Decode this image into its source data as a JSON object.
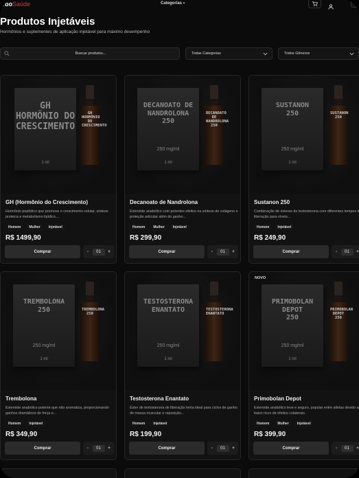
{
  "header": {
    "logo_main": "urbo",
    "logo_accent": "Saúde",
    "categories_menu": "Categorias"
  },
  "page": {
    "title": "Produtos Injetáveis",
    "subtitle": "Hormônios e suplementes de aplicação injetável para máximo desempenho"
  },
  "filters": {
    "search_placeholder": "Buscar produtos...",
    "category_select": "Todas Categorias",
    "gender_select": "Todos Gêneros"
  },
  "colors": {
    "background": "#0b0b0b",
    "card": "#121212",
    "button": "#2b2b2b",
    "logo_accent": "#d9363e"
  },
  "products": [
    {
      "name": "GH (Hormônio do Crescimento)",
      "description": "Hormônio peptídico que promove o crescimento celular, síntese proteica e metabolismo lipídico,...",
      "tags": [
        "Homem",
        "Mulher",
        "Injetável"
      ],
      "price": "R$ 1499,90",
      "box_text": "GH\nHORMÔNIO DO\nCRESCIMENTO",
      "box_dose": "",
      "box_ml": "1 ml",
      "vial_label": "GH\nHORMÔNIO\nDO\nCRESCIMENTO",
      "buy_label": "Comprar",
      "quantity": "01",
      "badge": ""
    },
    {
      "name": "Decanoato de Nandrolona",
      "description": "Esteroide anabólico com potentes efeitos na síntese de colágeno e proteção articular além do ganho...",
      "tags": [
        "Homem",
        "Mulher",
        "Injetável"
      ],
      "price": "R$ 299,90",
      "box_text": "DECANOATO DE\nNANDROLONA\n250",
      "box_dose": "250 mg/ml",
      "box_ml": "1 ml",
      "vial_label": "DECANOATO\nDE\nNANDROLONA\n250",
      "buy_label": "Comprar",
      "quantity": "01",
      "badge": ""
    },
    {
      "name": "Sustanon 250",
      "description": "Combinação de ésteres de testosterona com diferentes tempos de liberação para níveis...",
      "tags": [
        "Homem",
        "Injetável"
      ],
      "price": "R$ 249,90",
      "box_text": "SUSTANON\n250",
      "box_dose": "250 mg/ml",
      "box_ml": "1 ml",
      "vial_label": "SUSTANON\n250",
      "buy_label": "Comprar",
      "quantity": "01",
      "badge": ""
    },
    {
      "name": "Trembolona",
      "description": "Esteroide anabólico potente que não aromatiza, proporcionando ganhos dramáticos de força e...",
      "tags": [
        "Homem",
        "Injetável"
      ],
      "price": "R$ 349,90",
      "box_text": "TREMBOLONA\n250",
      "box_dose": "250 mg/ml",
      "box_ml": "1 ml",
      "vial_label": "TREMBOLONA\n250",
      "buy_label": "Comprar",
      "quantity": "01",
      "badge": ""
    },
    {
      "name": "Testosterona Enantato",
      "description": "Éster de testosterona de liberação lenta ideal para ciclos de ganho de massa muscular e reposição...",
      "tags": [
        "Homem",
        "Injetável"
      ],
      "price": "R$ 199,90",
      "box_text": "TESTOSTERONA\nENANTATO",
      "box_dose": "250 mg/ml",
      "box_ml": "1 ml",
      "vial_label": "TESTOSTERONA\nENANTATO",
      "buy_label": "Comprar",
      "quantity": "01",
      "badge": ""
    },
    {
      "name": "Primobolan Depot",
      "description": "Esteroide anabólico leve e seguro, popular entre atletas devido ao baixo risco de efeitos colaterais.",
      "tags": [
        "Homem",
        "Mulher",
        "Injetável"
      ],
      "price": "R$ 399,90",
      "box_text": "PRIMOBOLAN\nDEPOT\n250",
      "box_dose": "250 mg/ml",
      "box_ml": "1 ml",
      "vial_label": "PRIMOBOLAN\nDEPOT\n250",
      "buy_label": "Comprar",
      "quantity": "01",
      "badge": "NOVO"
    }
  ]
}
